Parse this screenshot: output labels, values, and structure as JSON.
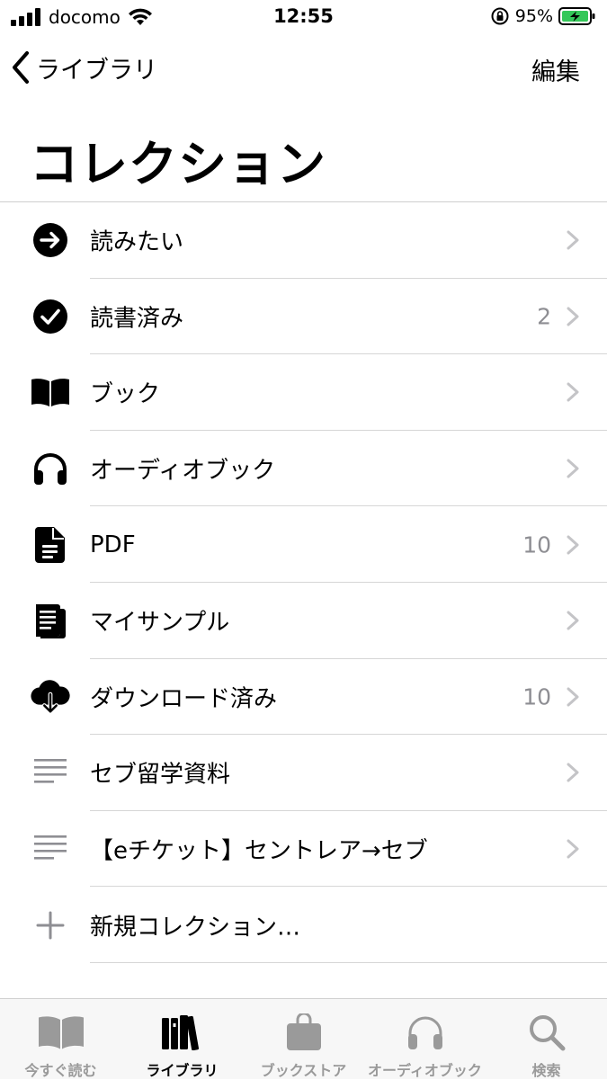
{
  "status_bar": {
    "carrier": "docomo",
    "time": "12:55",
    "battery": "95%"
  },
  "nav": {
    "back_label": "ライブラリ",
    "edit_label": "編集"
  },
  "page": {
    "title": "コレクション"
  },
  "collections": [
    {
      "label": "読みたい",
      "count": "",
      "icon": "arrow-circle-icon"
    },
    {
      "label": "読書済み",
      "count": "2",
      "icon": "checkmark-circle-icon"
    },
    {
      "label": "ブック",
      "count": "",
      "icon": "open-book-icon"
    },
    {
      "label": "オーディオブック",
      "count": "",
      "icon": "headphones-icon"
    },
    {
      "label": "PDF",
      "count": "10",
      "icon": "document-icon"
    },
    {
      "label": "マイサンプル",
      "count": "",
      "icon": "sample-pages-icon"
    },
    {
      "label": "ダウンロード済み",
      "count": "10",
      "icon": "cloud-download-icon"
    },
    {
      "label": "セブ留学資料",
      "count": "",
      "icon": "list-lines-icon"
    },
    {
      "label": "【eチケット】セントレア→セブ",
      "count": "",
      "icon": "list-lines-icon"
    },
    {
      "label": "新規コレクション…",
      "count": "",
      "icon": "plus-icon"
    }
  ],
  "tab_bar": {
    "active": "ライブラリ",
    "tabs": [
      {
        "label": "今すぐ読む",
        "icon": "reading-now-icon"
      },
      {
        "label": "ライブラリ",
        "icon": "library-icon"
      },
      {
        "label": "ブックストア",
        "icon": "bag-icon"
      },
      {
        "label": "オーディオブック",
        "icon": "headphones-icon"
      },
      {
        "label": "検索",
        "icon": "search-icon"
      }
    ]
  },
  "colors": {
    "accent": "#000000",
    "secondary_text": "#8e8e93",
    "battery_green": "#34c759",
    "tab_inactive": "#9a9a9a"
  }
}
